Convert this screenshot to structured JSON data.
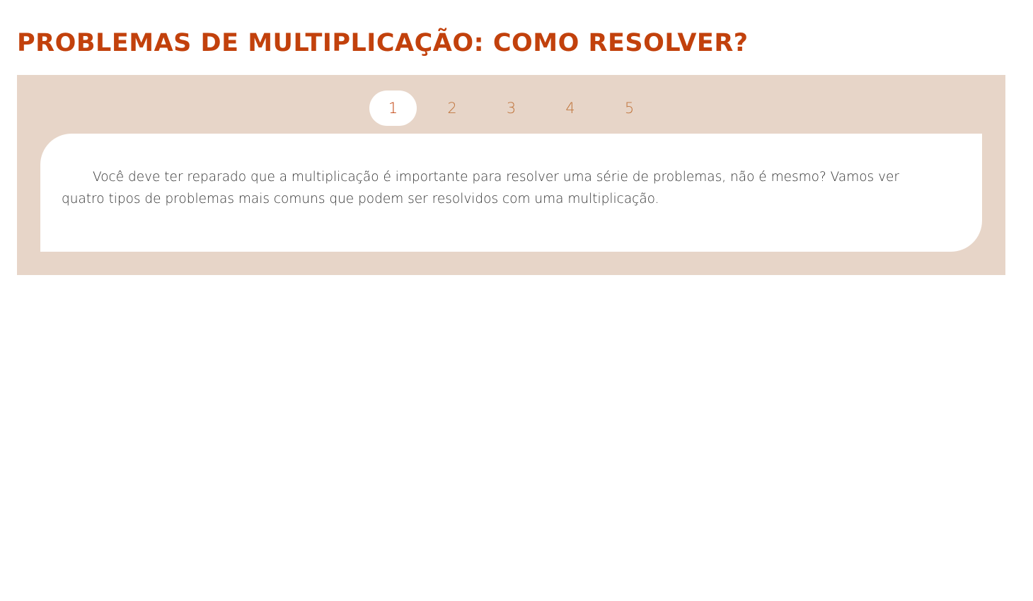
{
  "header": {
    "title": "PROBLEMAS DE MULTIPLICAÇÃO: COMO RESOLVER?"
  },
  "carousel": {
    "pages": [
      {
        "label": "1",
        "active": true
      },
      {
        "label": "2",
        "active": false
      },
      {
        "label": "3",
        "active": false
      },
      {
        "label": "4",
        "active": false
      },
      {
        "label": "5",
        "active": false
      }
    ],
    "slide_text": "Você deve ter reparado que a multiplicação é importante para resolver uma série de problemas, não é mesmo? Vamos ver quatro tipos de problemas mais comuns que podem ser resolvidos com uma multiplicação."
  },
  "colors": {
    "title": "#c2410c",
    "panel_background": "#e7d5c8",
    "pager_text": "#c0753d",
    "body_text": "#333333"
  }
}
